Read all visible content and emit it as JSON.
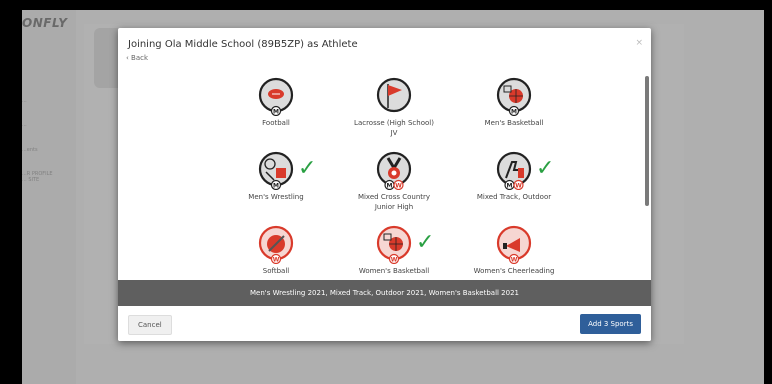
{
  "app": {
    "logo_text": "ONFLY"
  },
  "background": {
    "nav": [
      "...",
      "...",
      "...ents",
      "...R PROFILE\n... SITE"
    ]
  },
  "modal": {
    "title": "Joining Ola Middle School (89B5ZP) as Athlete",
    "back_label": "‹ Back",
    "close_glyph": "×",
    "selected_summary": "Men's Wrestling 2021, Mixed Track, Outdoor 2021, Women's Basketball 2021",
    "cancel_label": "Cancel",
    "add_label": "Add 3 Sports",
    "sports": [
      {
        "label": "Football",
        "badges": [
          "M"
        ],
        "icon": "football-icon",
        "selected": false
      },
      {
        "label": "Lacrosse (High School)",
        "sub": "JV",
        "badges": [],
        "icon": "lacrosse-flag-icon",
        "selected": false
      },
      {
        "label": "Men's Basketball",
        "badges": [
          "M"
        ],
        "icon": "basketball-icon",
        "selected": false
      },
      {
        "label": "Men's Wrestling",
        "badges": [
          "M"
        ],
        "icon": "wrestling-icon",
        "selected": true
      },
      {
        "label": "Mixed Cross Country",
        "sub": "Junior High",
        "badges": [
          "M",
          "W"
        ],
        "icon": "cross-country-medal-icon",
        "selected": false
      },
      {
        "label": "Mixed Track, Outdoor",
        "badges": [
          "M",
          "W"
        ],
        "icon": "track-icon",
        "selected": true
      },
      {
        "label": "Softball",
        "badges": [
          "W"
        ],
        "icon": "softball-icon",
        "selected": false
      },
      {
        "label": "Women's Basketball",
        "badges": [
          "W"
        ],
        "icon": "basketball-icon",
        "selected": true
      },
      {
        "label": "Women's Cheerleading",
        "badges": [
          "W"
        ],
        "icon": "cheer-megaphone-icon",
        "selected": false
      }
    ]
  },
  "colors": {
    "accent_red": "#d93a2b",
    "check_green": "#2aa043",
    "primary_button": "#2f5f9a",
    "summary_bar": "#5f5f5f"
  }
}
